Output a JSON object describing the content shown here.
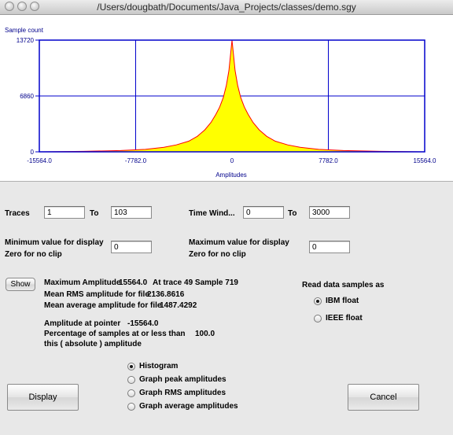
{
  "window": {
    "title": "/Users/dougbath/Documents/Java_Projects/classes/demo.sgy"
  },
  "chart_data": {
    "type": "area",
    "ylabel": "Sample count",
    "xlabel": "Amplitudes",
    "y_ticks": [
      "13720",
      "6860",
      "0"
    ],
    "x_ticks": [
      "-15564.0",
      "-7782.0",
      "0",
      "7782.0",
      "15564.0"
    ],
    "xlim": [
      -15564.0,
      15564.0
    ],
    "ylim": [
      0,
      13720
    ],
    "grid": true,
    "colors": {
      "fill": "#ffff00",
      "line": "#ff0000",
      "axes": "#0000cc",
      "text": "#00008b"
    },
    "x": [
      -15564,
      -12000,
      -9000,
      -7000,
      -5500,
      -4500,
      -3500,
      -2800,
      -2200,
      -1700,
      -1300,
      -1000,
      -700,
      -450,
      -250,
      -100,
      0,
      100,
      250,
      450,
      700,
      1000,
      1300,
      1700,
      2200,
      2800,
      3500,
      4500,
      5500,
      7000,
      9000,
      12000,
      15564
    ],
    "y": [
      0,
      60,
      150,
      300,
      550,
      850,
      1300,
      1900,
      2700,
      3600,
      4600,
      5500,
      6700,
      8200,
      10000,
      12200,
      13720,
      12200,
      10000,
      8200,
      6700,
      5500,
      4600,
      3600,
      2700,
      1900,
      1300,
      850,
      550,
      300,
      150,
      60,
      0
    ]
  },
  "traces": {
    "label": "Traces",
    "from": "1",
    "to_label": "To",
    "to": "103"
  },
  "time_window": {
    "label": "Time Wind...",
    "from": "0",
    "to_label": "To",
    "to": "3000"
  },
  "min_display": {
    "line1": "Minimum value for display",
    "line2": "Zero for no clip",
    "value": "0"
  },
  "max_display": {
    "line1": "Maximum value for display",
    "line2": "Zero for no clip",
    "value": "0"
  },
  "show_button": "Show",
  "stats": {
    "max_amplitude_label": "Maximum Amplitude",
    "max_amplitude": "15564.0",
    "max_location": "At trace 49 Sample 719",
    "rms_label": "Mean RMS amplitude for file",
    "rms": "2136.8616",
    "avg_label": "Mean average amplitude for file",
    "avg": "1487.4292",
    "pointer_label": "Amplitude at pointer",
    "pointer": "-15564.0",
    "percent_line1": "Percentage of samples at or less than",
    "percent": "100.0",
    "percent_line2": "this ( absolute ) amplitude"
  },
  "read_as": {
    "label": "Read data samples as",
    "options": [
      {
        "label": "IBM float",
        "selected": true
      },
      {
        "label": "IEEE float",
        "selected": false
      }
    ]
  },
  "graph_options": [
    {
      "label": "Histogram",
      "selected": true
    },
    {
      "label": "Graph peak amplitudes",
      "selected": false
    },
    {
      "label": "Graph RMS amplitudes",
      "selected": false
    },
    {
      "label": "Graph average amplitudes",
      "selected": false
    }
  ],
  "display_button": "Display",
  "cancel_button": "Cancel"
}
